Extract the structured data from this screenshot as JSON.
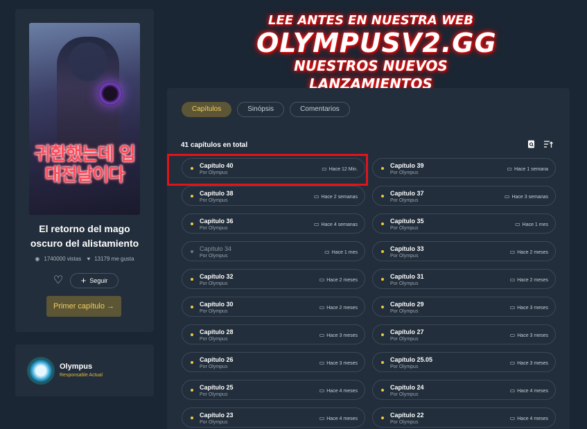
{
  "series": {
    "cover_korean_title": "귀환했는데 입대전날이다",
    "title": "El retorno del mago oscuro del alistamiento",
    "views": "1740000 vistas",
    "likes": "13179 me gusta",
    "follow_label": "Seguir",
    "first_chapter_label": "Primer capítulo →"
  },
  "owner": {
    "name": "Olympus",
    "role": "Responsable Actual"
  },
  "banner": {
    "line1": "LEE ANTES EN NUESTRA WEB",
    "line2": "OLYMPUSV2.GG",
    "line3": "NUESTROS NUEVOS LANZAMIENTOS"
  },
  "tabs": [
    {
      "label": "Capítulos",
      "active": true
    },
    {
      "label": "Sinópsis",
      "active": false
    },
    {
      "label": "Comentarios",
      "active": false
    }
  ],
  "total_label": "41 capítulos en total",
  "icons": {
    "search": "search-icon",
    "sort": "sort-icon",
    "calendar": "calendar-icon",
    "heart": "heart-icon"
  },
  "colors": {
    "accent": "#f2cf5b",
    "unread_dot": "#f2cb3c",
    "highlight": "#e0141a"
  },
  "chapters": [
    {
      "title": "Capítulo 40",
      "author": "Por Olympus",
      "time": "Hace 12 Min.",
      "read": false
    },
    {
      "title": "Capítulo 39",
      "author": "Por Olympus",
      "time": "Hace 1 semana",
      "read": false
    },
    {
      "title": "Capítulo 38",
      "author": "Por Olympus",
      "time": "Hace 2 semanas",
      "read": false
    },
    {
      "title": "Capítulo 37",
      "author": "Por Olympus",
      "time": "Hace 3 semanas",
      "read": false
    },
    {
      "title": "Capítulo 36",
      "author": "Por Olympus",
      "time": "Hace 4 semanas",
      "read": false
    },
    {
      "title": "Capítulo 35",
      "author": "Por Olympus",
      "time": "Hace 1 mes",
      "read": false
    },
    {
      "title": "Capítulo 34",
      "author": "Por Olympus",
      "time": "Hace 1 mes",
      "read": true
    },
    {
      "title": "Capítulo 33",
      "author": "Por Olympus",
      "time": "Hace 2 meses",
      "read": false
    },
    {
      "title": "Capítulo 32",
      "author": "Por Olympus",
      "time": "Hace 2 meses",
      "read": false
    },
    {
      "title": "Capítulo 31",
      "author": "Por Olympus",
      "time": "Hace 2 meses",
      "read": false
    },
    {
      "title": "Capítulo 30",
      "author": "Por Olympus",
      "time": "Hace 2 meses",
      "read": false
    },
    {
      "title": "Capítulo 29",
      "author": "Por Olympus",
      "time": "Hace 3 meses",
      "read": false
    },
    {
      "title": "Capítulo 28",
      "author": "Por Olympus",
      "time": "Hace 3 meses",
      "read": false
    },
    {
      "title": "Capítulo 27",
      "author": "Por Olympus",
      "time": "Hace 3 meses",
      "read": false
    },
    {
      "title": "Capítulo 26",
      "author": "Por Olympus",
      "time": "Hace 3 meses",
      "read": false
    },
    {
      "title": "Capítulo 25.05",
      "author": "Por Olympus",
      "time": "Hace 3 meses",
      "read": false
    },
    {
      "title": "Capítulo 25",
      "author": "Por Olympus",
      "time": "Hace 4 meses",
      "read": false
    },
    {
      "title": "Capítulo 24",
      "author": "Por Olympus",
      "time": "Hace 4 meses",
      "read": false
    },
    {
      "title": "Capítulo 23",
      "author": "Por Olympus",
      "time": "Hace 4 meses",
      "read": false
    },
    {
      "title": "Capítulo 22",
      "author": "Por Olympus",
      "time": "Hace 4 meses",
      "read": false
    }
  ]
}
